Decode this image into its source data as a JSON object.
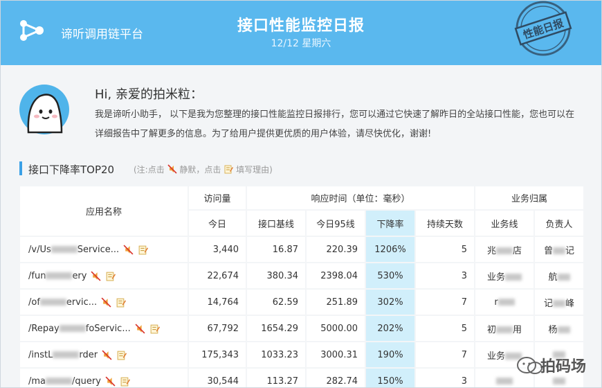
{
  "header": {
    "brand": "谛听调用链平台",
    "title": "接口性能监控日报",
    "date": "12/12 星期六",
    "stamp": "性能日报"
  },
  "intro": {
    "greeting": "Hi, 亲爱的拍米粒：",
    "message": "我是谛听小助手， 以下是我为您整理的接口性能监控日报排行，您可以通过它快速了解昨日的全站接口性能，您也可以在详细报告中了解更多的信息。为了给用户提供更优质的用户体验，请尽快优化，谢谢!"
  },
  "section": {
    "title": "接口下降率TOP20",
    "note_prefix": "(注:点击",
    "note_mute": "静默，点击",
    "note_reason": "填写理由)"
  },
  "table": {
    "headers": {
      "app_name": "应用名称",
      "visits": "访问量",
      "response_time": "响应时间（单位：毫秒）",
      "business": "业务归属",
      "today": "今日",
      "baseline": "接口基线",
      "p95": "今日95线",
      "drop_rate": "下降率",
      "days": "持续天数",
      "business_line": "业务线",
      "owner": "负责人"
    },
    "rows": [
      {
        "name_a": "/v/Us",
        "name_b": "Service...",
        "visits": "3,440",
        "baseline": "16.87",
        "p95": "220.39",
        "drop": "1206%",
        "days": "5",
        "line_a": "兆",
        "line_b": "店",
        "owner_a": "曾",
        "owner_b": "记"
      },
      {
        "name_a": "/fun",
        "name_b": "ery",
        "visits": "22,674",
        "baseline": "380.34",
        "p95": "2398.04",
        "drop": "530%",
        "days": "3",
        "line_a": "业务",
        "line_b": "",
        "owner_a": "航",
        "owner_b": ""
      },
      {
        "name_a": "/of",
        "name_b": "ervic...",
        "visits": "14,764",
        "baseline": "62.59",
        "p95": "251.89",
        "drop": "302%",
        "days": "7",
        "line_a": "r",
        "line_b": "",
        "owner_a": "记",
        "owner_b": "峰"
      },
      {
        "name_a": "/Repay",
        "name_b": "foServic...",
        "visits": "67,792",
        "baseline": "1654.29",
        "p95": "5000.00",
        "drop": "202%",
        "days": "5",
        "line_a": "初",
        "line_b": "用",
        "owner_a": "杨",
        "owner_b": ""
      },
      {
        "name_a": "/instL",
        "name_b": "rder",
        "visits": "175,343",
        "baseline": "1033.23",
        "p95": "3000.31",
        "drop": "190%",
        "days": "7",
        "line_a": "业务",
        "line_b": "",
        "owner_a": "",
        "owner_b": ""
      },
      {
        "name_a": "/ma",
        "name_b": "/query",
        "visits": "30,544",
        "baseline": "113.27",
        "p95": "282.74",
        "drop": "150%",
        "days": "3",
        "line_a": "",
        "line_b": "",
        "owner_a": "",
        "owner_b": ""
      }
    ]
  },
  "watermark": "拍码场",
  "colors": {
    "header_bg": "#5ab8ee",
    "highlight": "#d1effb",
    "accent": "#3aa0e6"
  }
}
